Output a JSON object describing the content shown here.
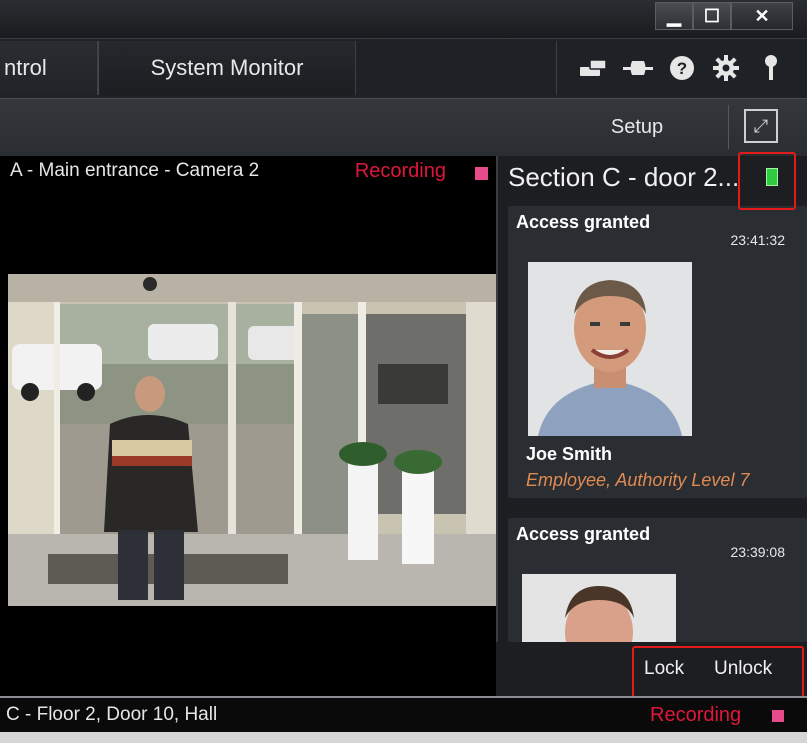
{
  "window": {
    "minimize_glyph": "▁",
    "maximize_glyph": "☐",
    "close_glyph": "✕"
  },
  "tabs": [
    {
      "label": "ntrol"
    },
    {
      "label": "System Monitor"
    }
  ],
  "header_icons": [
    "devices-icon",
    "connection-icon",
    "help-icon",
    "settings-icon",
    "pin-icon"
  ],
  "toolbar": {
    "setup_label": "Setup",
    "expand_glyph": "⤢"
  },
  "camera_main": {
    "title": "A - Main entrance - Camera 2",
    "status": "Recording"
  },
  "access_panel": {
    "title": "Section C - door 2...",
    "events": [
      {
        "status": "Access granted",
        "time": "23:41:32",
        "name": "Joe Smith",
        "role": "Employee, Authority Level 7"
      },
      {
        "status": "Access granted",
        "time": "23:39:08"
      }
    ],
    "lock_label": "Lock",
    "unlock_label": "Unlock"
  },
  "camera_bottom": {
    "title": "C - Floor 2, Door 10, Hall",
    "status": "Recording"
  },
  "colors": {
    "recording": "#e0173a",
    "role_text": "#e08a52",
    "annotation_frame": "#e21a1a",
    "door_status": "#2ecc40"
  }
}
